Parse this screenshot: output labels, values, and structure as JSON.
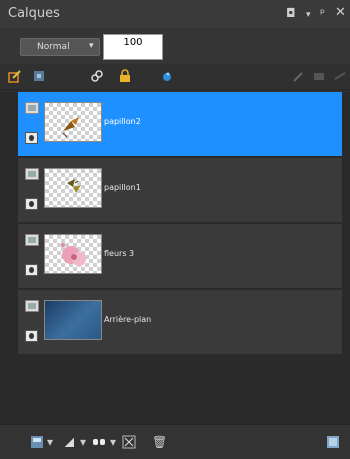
{
  "panel": {
    "title": "Calques",
    "window_controls": [
      "◘",
      "▾",
      "ᵖ",
      "✕"
    ]
  },
  "blend": {
    "mode": "Normal",
    "arrow": "▾",
    "opacity": "100"
  },
  "toolbar_icons": [
    "new-raster-layer-icon",
    "new-mask-icon",
    "link-icon",
    "lock-icon",
    "color-drop-icon",
    "properties-icon",
    "group-icon",
    "merge-icon"
  ],
  "layers": [
    {
      "name": "papillon2",
      "selected": true,
      "thumb": "butterfly"
    },
    {
      "name": "papillon1",
      "selected": false,
      "thumb": "butterfly"
    },
    {
      "name": "fleurs 3",
      "selected": false,
      "thumb": "flower"
    },
    {
      "name": "Arrière-plan",
      "selected": false,
      "thumb": "background"
    }
  ],
  "bottom_bar": {
    "new_layer_arrow": "▾",
    "mask_arrow": "▾",
    "group_arrow": "▾",
    "delete_icon": "🗑"
  },
  "colors": {
    "selected_layer": "#1e90ff",
    "panel_bg": "#2f2f2f"
  }
}
